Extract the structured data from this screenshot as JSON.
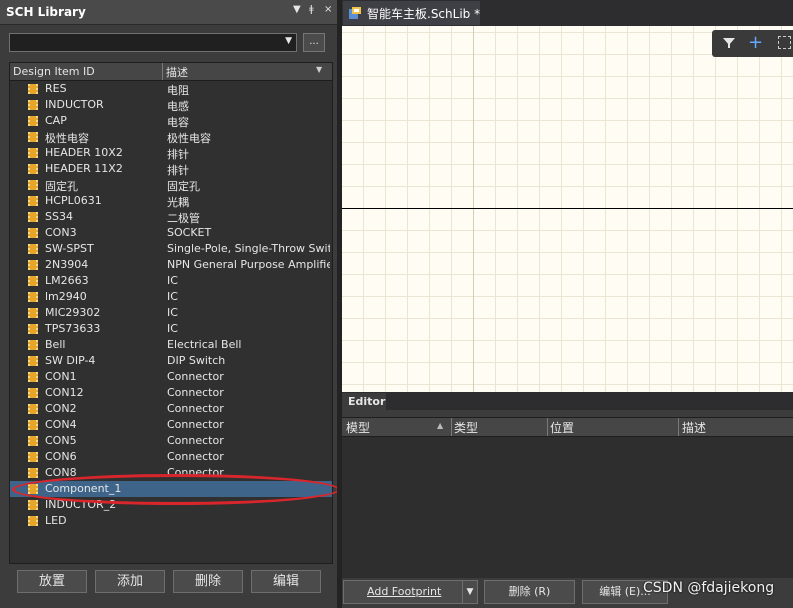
{
  "panel": {
    "title": "SCH Library",
    "header_icons": [
      "▼",
      "ǂ",
      "×"
    ],
    "library_select_value": "",
    "more_button_label": "...",
    "columns": [
      "Design Item ID",
      "描述"
    ],
    "column_sort_glyph": "▼",
    "items": [
      {
        "id": "RES",
        "desc": "电阻"
      },
      {
        "id": "INDUCTOR",
        "desc": "电感"
      },
      {
        "id": "CAP",
        "desc": "电容"
      },
      {
        "id": "极性电容",
        "desc": "极性电容"
      },
      {
        "id": "HEADER 10X2",
        "desc": "排针"
      },
      {
        "id": "HEADER 11X2",
        "desc": "排针"
      },
      {
        "id": "固定孔",
        "desc": "固定孔"
      },
      {
        "id": "HCPL0631",
        "desc": "光耦"
      },
      {
        "id": "SS34",
        "desc": "二极管"
      },
      {
        "id": "CON3",
        "desc": "SOCKET"
      },
      {
        "id": "SW-SPST",
        "desc": "Single-Pole, Single-Throw Switc"
      },
      {
        "id": "2N3904",
        "desc": "NPN General Purpose Amplifier"
      },
      {
        "id": "LM2663",
        "desc": "IC"
      },
      {
        "id": "lm2940",
        "desc": "IC"
      },
      {
        "id": "MIC29302",
        "desc": "IC"
      },
      {
        "id": "TPS73633",
        "desc": "IC"
      },
      {
        "id": "Bell",
        "desc": "Electrical Bell"
      },
      {
        "id": "SW DIP-4",
        "desc": "DIP Switch"
      },
      {
        "id": "CON1",
        "desc": "Connector"
      },
      {
        "id": "CON12",
        "desc": "Connector"
      },
      {
        "id": "CON2",
        "desc": "Connector"
      },
      {
        "id": "CON4",
        "desc": "Connector"
      },
      {
        "id": "CON5",
        "desc": "Connector"
      },
      {
        "id": "CON6",
        "desc": "Connector"
      },
      {
        "id": "CON8",
        "desc": "Connector"
      },
      {
        "id": "Component_1",
        "desc": ""
      },
      {
        "id": "INDUCTOR_2",
        "desc": ""
      },
      {
        "id": "LED",
        "desc": ""
      }
    ],
    "selected_item": "Component_1",
    "buttons": {
      "place": "放置",
      "add": "添加",
      "delete": "删除",
      "edit": "编辑"
    }
  },
  "document_tab": {
    "label": "智能车主板.SchLib *"
  },
  "canvas_toolbar": {
    "icons": [
      "filter-icon",
      "plus-icon",
      "select-rect-icon"
    ]
  },
  "editor": {
    "label": "Editor",
    "columns": [
      "模型",
      "类型",
      "位置",
      "描述"
    ],
    "sort_glyph": "▲",
    "buttons": {
      "add_footprint": "Add Footprint",
      "dropdown": "▼",
      "delete": "删除",
      "delete_key": "(R)",
      "edit": "编辑",
      "edit_key": "(E)..."
    }
  },
  "watermark": "CSDN @fdajiekong",
  "colors": {
    "selection": "#3e6589",
    "highlight_ellipse": "#d9262c",
    "chip_icon": "#e4a72c",
    "canvas": "#fffdf3"
  }
}
